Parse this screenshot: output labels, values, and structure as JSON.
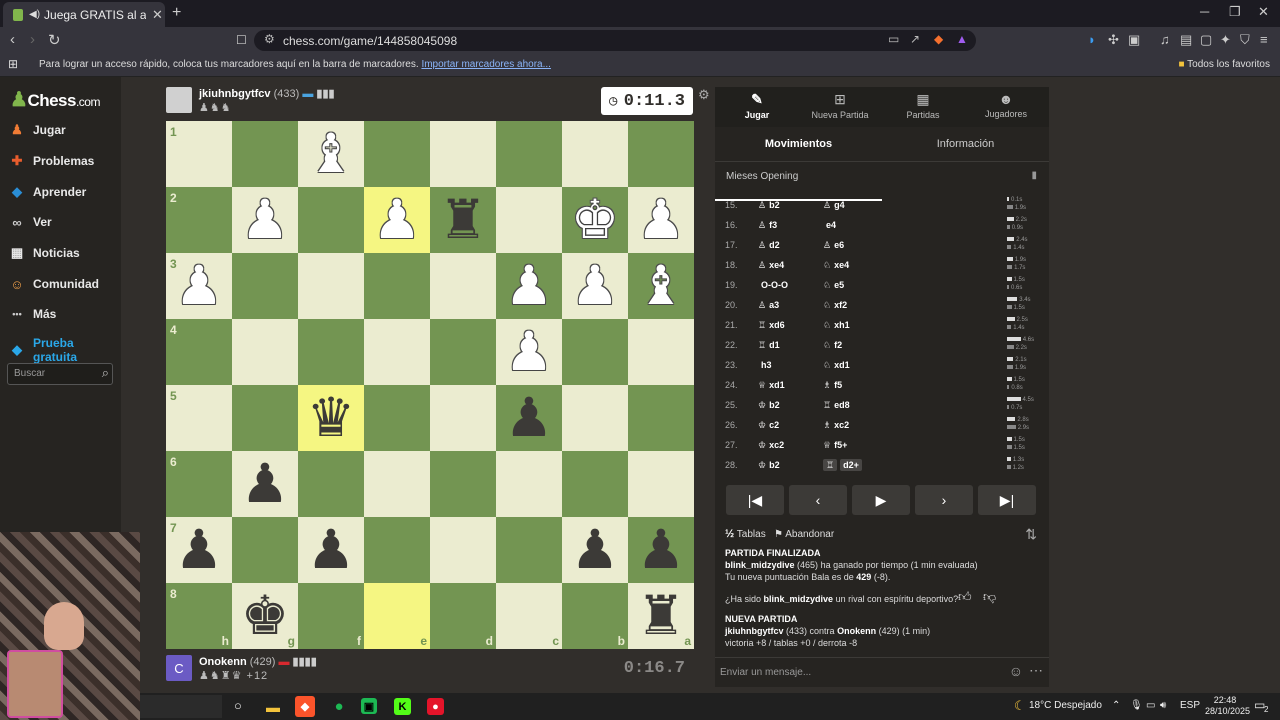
{
  "browser": {
    "tab_title": "Juega GRATIS al ajedrez online",
    "url": "chess.com/game/144858045098",
    "bookmark_msg": "Para lograr un acceso rápido, coloca tus marcadores aquí en la barra de marcadores.",
    "bookmark_link": "Importar marcadores ahora...",
    "all_bookmarks": "Todos los favoritos"
  },
  "sidebar": {
    "logo_main": "Chess",
    "logo_suffix": ".com",
    "items": [
      {
        "label": "Jugar",
        "icon": "pawn-icon",
        "color": "#f07c35"
      },
      {
        "label": "Problemas",
        "icon": "puzzle-icon",
        "color": "#e85d2d"
      },
      {
        "label": "Aprender",
        "icon": "graduation-icon",
        "color": "#2a8ed6"
      },
      {
        "label": "Ver",
        "icon": "binoculars-icon",
        "color": "#cccccc"
      },
      {
        "label": "Noticias",
        "icon": "newspaper-icon",
        "color": "#e8e8e8"
      },
      {
        "label": "Comunidad",
        "icon": "community-icon",
        "color": "#f0a04a"
      },
      {
        "label": "Más",
        "icon": "more-icon",
        "color": "#cccccc"
      },
      {
        "label": "Prueba gratuita",
        "icon": "diamond-icon",
        "color": "#2aa7e8"
      }
    ],
    "search_placeholder": "Buscar"
  },
  "top_player": {
    "name": "jkiuhnbgytfcv",
    "rating": "(433)",
    "captured": "♟♞♞",
    "clock": "0:11.3"
  },
  "bottom_player": {
    "name": "Onokenn",
    "rating": "(429)",
    "captured": "♟♞♜♛",
    "extra": "+12",
    "clock": "0:16.7",
    "avatar_letter": "C"
  },
  "board": {
    "ranks": [
      "1",
      "2",
      "3",
      "4",
      "5",
      "6",
      "7",
      "8"
    ],
    "files": [
      "h",
      "g",
      "f",
      "e",
      "d",
      "c",
      "b",
      "a"
    ],
    "highlight": [
      "e2",
      "f5",
      "e8"
    ],
    "pieces": [
      {
        "sq": "f1",
        "p": "♝",
        "c": "w"
      },
      {
        "sq": "g2",
        "p": "♟",
        "c": "w"
      },
      {
        "sq": "e2",
        "p": "♟",
        "c": "w"
      },
      {
        "sq": "d2",
        "p": "♜",
        "c": "b"
      },
      {
        "sq": "b2",
        "p": "♚",
        "c": "w"
      },
      {
        "sq": "a2",
        "p": "♟",
        "c": "w"
      },
      {
        "sq": "h3",
        "p": "♟",
        "c": "w"
      },
      {
        "sq": "c3",
        "p": "♟",
        "c": "w"
      },
      {
        "sq": "b3",
        "p": "♟",
        "c": "w"
      },
      {
        "sq": "a3",
        "p": "♝",
        "c": "w"
      },
      {
        "sq": "c4",
        "p": "♟",
        "c": "w"
      },
      {
        "sq": "f5",
        "p": "♛",
        "c": "b"
      },
      {
        "sq": "c5",
        "p": "♟",
        "c": "b"
      },
      {
        "sq": "g6",
        "p": "♟",
        "c": "b"
      },
      {
        "sq": "h7",
        "p": "♟",
        "c": "b"
      },
      {
        "sq": "f7",
        "p": "♟",
        "c": "b"
      },
      {
        "sq": "b7",
        "p": "♟",
        "c": "b"
      },
      {
        "sq": "a7",
        "p": "♟",
        "c": "b"
      },
      {
        "sq": "g8",
        "p": "♚",
        "c": "b"
      },
      {
        "sq": "a8",
        "p": "♜",
        "c": "b"
      }
    ]
  },
  "panel": {
    "tabs": [
      {
        "label": "Jugar",
        "icon": "pen-icon"
      },
      {
        "label": "Nueva Partida",
        "icon": "plus-icon"
      },
      {
        "label": "Partidas",
        "icon": "board-icon"
      },
      {
        "label": "Jugadores",
        "icon": "players-icon"
      }
    ],
    "subtabs": [
      "Movimientos",
      "Información"
    ],
    "opening": "Mieses Opening",
    "moves": [
      {
        "n": "15.",
        "wi": "♙",
        "w": "b2",
        "bi": "♙",
        "b": "g4",
        "t1": "0.1s",
        "t2": "1.9s"
      },
      {
        "n": "16.",
        "wi": "♙",
        "w": "f3",
        "bi": "",
        "b": "e4",
        "t1": "2.2s",
        "t2": "0.9s"
      },
      {
        "n": "17.",
        "wi": "♙",
        "w": "d2",
        "bi": "♙",
        "b": "e6",
        "t1": "2.4s",
        "t2": "1.4s"
      },
      {
        "n": "18.",
        "wi": "♙",
        "w": "xe4",
        "bi": "♘",
        "b": "xe4",
        "t1": "1.9s",
        "t2": "1.7s"
      },
      {
        "n": "19.",
        "wi": "",
        "w": "O-O-O",
        "bi": "♘",
        "b": "e5",
        "t1": "1.5s",
        "t2": "0.6s"
      },
      {
        "n": "20.",
        "wi": "♙",
        "w": "a3",
        "bi": "♘",
        "b": "xf2",
        "t1": "3.4s",
        "t2": "1.5s"
      },
      {
        "n": "21.",
        "wi": "♖",
        "w": "xd6",
        "bi": "♘",
        "b": "xh1",
        "t1": "2.5s",
        "t2": "1.4s"
      },
      {
        "n": "22.",
        "wi": "♖",
        "w": "d1",
        "bi": "♘",
        "b": "f2",
        "t1": "4.6s",
        "t2": "2.2s"
      },
      {
        "n": "23.",
        "wi": "",
        "w": "h3",
        "bi": "♘",
        "b": "xd1",
        "t1": "2.1s",
        "t2": "1.9s"
      },
      {
        "n": "24.",
        "wi": "♕",
        "w": "xd1",
        "bi": "♗",
        "b": "f5",
        "t1": "1.5s",
        "t2": "0.8s"
      },
      {
        "n": "25.",
        "wi": "♔",
        "w": "b2",
        "bi": "♖",
        "b": "ed8",
        "t1": "4.5s",
        "t2": "0.7s"
      },
      {
        "n": "26.",
        "wi": "♔",
        "w": "c2",
        "bi": "♗",
        "b": "xc2",
        "t1": "2.8s",
        "t2": "2.9s"
      },
      {
        "n": "27.",
        "wi": "♔",
        "w": "xc2",
        "bi": "♕",
        "b": "f5+",
        "t1": "1.5s",
        "t2": "1.5s"
      },
      {
        "n": "28.",
        "wi": "♔",
        "w": "b2",
        "bi": "♖",
        "b": "d2+",
        "t1": "1.3s",
        "t2": "1.2s"
      }
    ],
    "draw_label": "Tablas",
    "resign_label": "Abandonar",
    "chat": {
      "ended_header": "PARTIDA FINALIZADA",
      "winner": "blink_midzydive",
      "win_text_rating": "(465)",
      "win_text": "ha ganado por tiempo (1 min evaluada)",
      "new_rating_text": "Tu nueva puntuación Bala es de",
      "new_rating": "429",
      "rating_delta": "(-8).",
      "sport_q_pre": "¿Ha sido",
      "sport_q_name": "blink_midzydive",
      "sport_q_post": "un rival con espíritu deportivo?",
      "new_game_header": "NUEVA PARTIDA",
      "ng_p1": "jkiuhnbgytfcv",
      "ng_p1_rating": "(433) contra",
      "ng_p2": "Onokenn",
      "ng_p2_rating": "(429) (1 min)",
      "record": "victoria +8 / tablas +0 / derrota -8"
    },
    "message_placeholder": "Enviar un mensaje..."
  },
  "taskbar": {
    "weather": "18°C Despejado",
    "lang": "ESP",
    "time": "22:48",
    "date": "28/10/2025",
    "notif": "2"
  }
}
